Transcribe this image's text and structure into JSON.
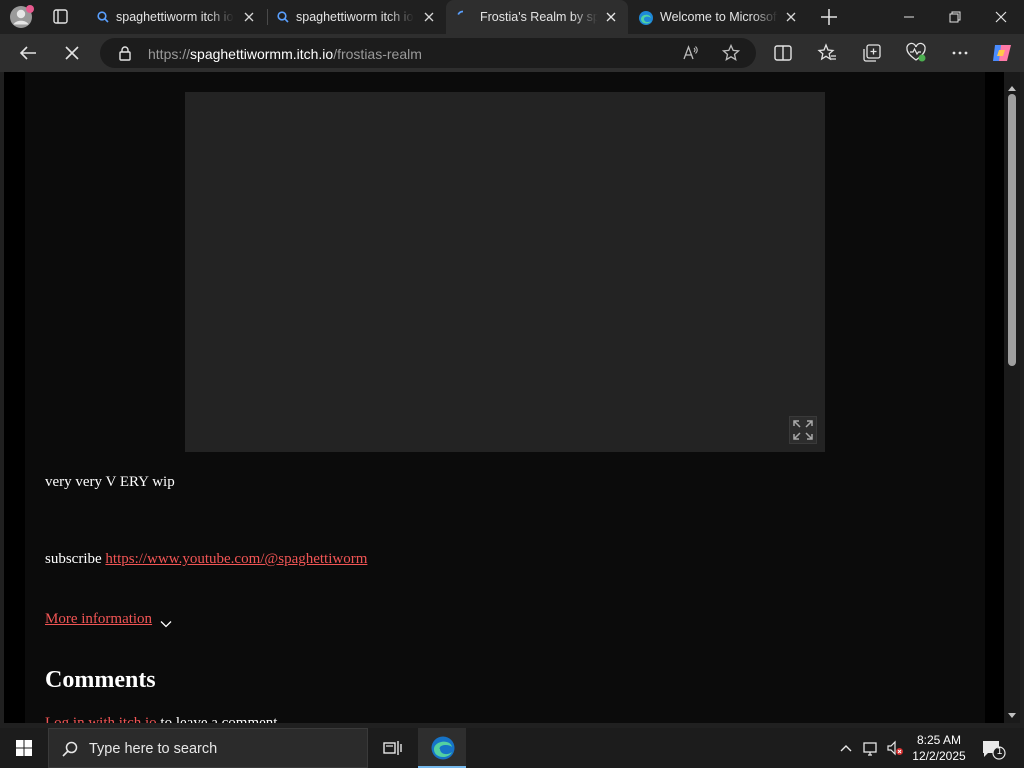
{
  "browser": {
    "tabs": [
      {
        "title": "spaghettiworm itch io",
        "icon": "search-icon",
        "active": false
      },
      {
        "title": "spaghettiworm itch io",
        "icon": "search-icon",
        "active": false
      },
      {
        "title": "Frostia's Realm by spaghettiwormm",
        "icon": "itch-loading-icon",
        "active": true
      },
      {
        "title": "Welcome to Microsoft Edge",
        "icon": "edge-icon",
        "active": false
      }
    ],
    "address": {
      "scheme": "https://",
      "host": "spaghettiwormm.itch.io",
      "path": "/frostias-realm"
    }
  },
  "page": {
    "description_line1": "very very V ERY wip",
    "subscribe_label": "subscribe",
    "youtube_link": "https://www.youtube.com/@spaghettiworm",
    "more_info_label": "More information",
    "comments_heading": "Comments",
    "login_link": "Log in with itch.io",
    "login_suffix": "to leave a comment."
  },
  "taskbar": {
    "search_placeholder": "Type here to search",
    "time": "8:25 AM",
    "date": "12/2/2025",
    "notification_count": "1"
  },
  "colors": {
    "link": "#f25555",
    "page_bg": "#0b0b0b",
    "embed_bg": "#232323",
    "edge_accent": "#76b9ed"
  }
}
